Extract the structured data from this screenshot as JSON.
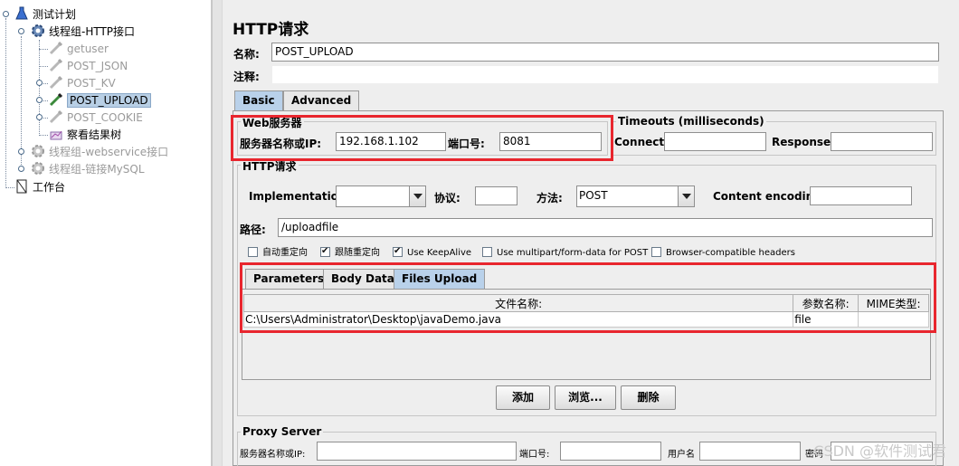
{
  "tree": {
    "root": "测试计划",
    "group1": "线程组-HTTP接口",
    "samplers": [
      "getuser",
      "POST_JSON",
      "POST_KV",
      "POST_UPLOAD",
      "POST_COOKIE"
    ],
    "listener": "察看结果树",
    "group2": "线程组-webservice接口",
    "group3": "线程组-链接MySQL",
    "workbench": "工作台"
  },
  "main": {
    "title": "HTTP请求",
    "name_label": "名称:",
    "name_value": "POST_UPLOAD",
    "comment_label": "注释:",
    "comment_value": "",
    "tabs": [
      "Basic",
      "Advanced"
    ],
    "web_server": {
      "legend": "Web服务器",
      "server_label": "服务器名称或IP:",
      "server_value": "192.168.1.102",
      "port_label": "端口号:",
      "port_value": "8081"
    },
    "timeouts": {
      "legend": "Timeouts (milliseconds)",
      "connect_label": "Connect:",
      "connect_value": "",
      "response_label": "Response:",
      "response_value": ""
    },
    "http_request": {
      "legend": "HTTP请求",
      "implementation_label": "Implementation:",
      "implementation_value": "",
      "protocol_label": "协议:",
      "protocol_value": "",
      "method_label": "方法:",
      "method_value": "POST",
      "encoding_label": "Content encoding:",
      "encoding_value": "",
      "path_label": "路径:",
      "path_value": "/uploadfile",
      "checkboxes": [
        {
          "label": "自动重定向",
          "checked": false
        },
        {
          "label": "跟随重定向",
          "checked": true
        },
        {
          "label": "Use KeepAlive",
          "checked": true
        },
        {
          "label": "Use multipart/form-data for POST",
          "checked": false
        },
        {
          "label": "Browser-compatible headers",
          "checked": false
        }
      ]
    },
    "inner_tabs": [
      "Parameters",
      "Body Data",
      "Files Upload"
    ],
    "files_table": {
      "headers": [
        "文件名称:",
        "参数名称:",
        "MIME类型:"
      ],
      "rows": [
        [
          "C:\\Users\\Administrator\\Desktop\\javaDemo.java",
          "file",
          ""
        ]
      ]
    },
    "buttons": {
      "add": "添加",
      "browse": "浏览...",
      "delete": "删除"
    },
    "proxy": {
      "legend": "Proxy Server",
      "server_label": "服务器名称或IP:",
      "port_label": "端口号:",
      "user_label": "用户名",
      "password_label": "密码"
    }
  },
  "watermark": "CSDN @软件测试君"
}
